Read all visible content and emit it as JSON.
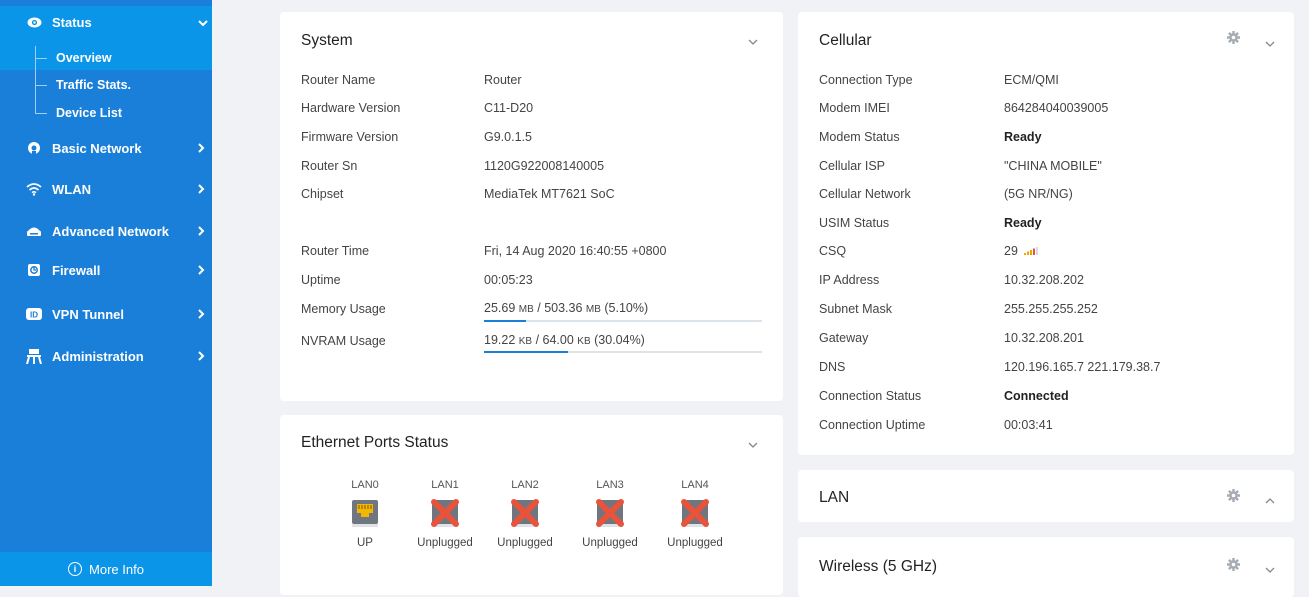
{
  "sidebar": {
    "items": [
      {
        "label": "Status",
        "icon": "eye-icon",
        "expanded": true
      },
      {
        "label": "Basic Network",
        "icon": "globe-icon"
      },
      {
        "label": "WLAN",
        "icon": "wifi-icon"
      },
      {
        "label": "Advanced Network",
        "icon": "router-icon"
      },
      {
        "label": "Firewall",
        "icon": "firewall-icon"
      },
      {
        "label": "VPN Tunnel",
        "icon": "vpn-icon"
      },
      {
        "label": "Administration",
        "icon": "admin-icon"
      }
    ],
    "status_sub": [
      "Overview",
      "Traffic Stats.",
      "Device List"
    ],
    "more_info": "More Info"
  },
  "system": {
    "title": "System",
    "rows": [
      {
        "label": "Router Name",
        "value": "Router"
      },
      {
        "label": "Hardware Version",
        "value": "C11-D20"
      },
      {
        "label": "Firmware Version",
        "value": "G9.0.1.5"
      },
      {
        "label": "Router Sn",
        "value": "1120G922008140005"
      },
      {
        "label": "Chipset",
        "value": "MediaTek MT7621 SoC"
      },
      {
        "label": "Router Time",
        "value": "Fri, 14 Aug 2020 16:40:55 +0800"
      },
      {
        "label": "Uptime",
        "value": "00:05:23"
      }
    ],
    "memory": {
      "label": "Memory Usage",
      "used": "25.69",
      "total": "503.36",
      "unit": "MB",
      "percent": "(5.10%)",
      "fraction": 0.051
    },
    "nvram": {
      "label": "NVRAM Usage",
      "used": "19.22",
      "total": "64.00",
      "unit": "KB",
      "percent": "(30.04%)",
      "fraction": 0.3004
    }
  },
  "ethernet": {
    "title": "Ethernet Ports Status",
    "ports": [
      {
        "name": "LAN0",
        "state": "UP",
        "connected": true
      },
      {
        "name": "LAN1",
        "state": "Unplugged",
        "connected": false
      },
      {
        "name": "LAN2",
        "state": "Unplugged",
        "connected": false
      },
      {
        "name": "LAN3",
        "state": "Unplugged",
        "connected": false
      },
      {
        "name": "LAN4",
        "state": "Unplugged",
        "connected": false
      }
    ]
  },
  "cellular": {
    "title": "Cellular",
    "rows": [
      {
        "label": "Connection Type",
        "value": "ECM/QMI"
      },
      {
        "label": "Modem IMEI",
        "value": "864284040039005"
      },
      {
        "label": "Modem Status",
        "value": "Ready",
        "bold": true
      },
      {
        "label": "Cellular ISP",
        "value": "\"CHINA MOBILE\""
      },
      {
        "label": "Cellular Network",
        "value": "(5G NR/NG)"
      },
      {
        "label": "USIM Status",
        "value": "Ready",
        "bold": true
      },
      {
        "label": "CSQ",
        "value": "29"
      },
      {
        "label": "IP Address",
        "value": "10.32.208.202"
      },
      {
        "label": "Subnet Mask",
        "value": "255.255.255.252"
      },
      {
        "label": "Gateway",
        "value": "10.32.208.201"
      },
      {
        "label": "DNS",
        "value": "120.196.165.7 221.179.38.7"
      },
      {
        "label": "Connection Status",
        "value": "Connected",
        "bold": true
      },
      {
        "label": "Connection Uptime",
        "value": "00:03:41"
      }
    ]
  },
  "lan": {
    "title": "LAN"
  },
  "wireless": {
    "title": "Wireless (5 GHz)"
  },
  "colors": {
    "sidebar": "#1a7fd8",
    "sidebar_active": "#0a95e8",
    "accent": "#1a7fd8",
    "unplugged_x": "#e8533c"
  }
}
